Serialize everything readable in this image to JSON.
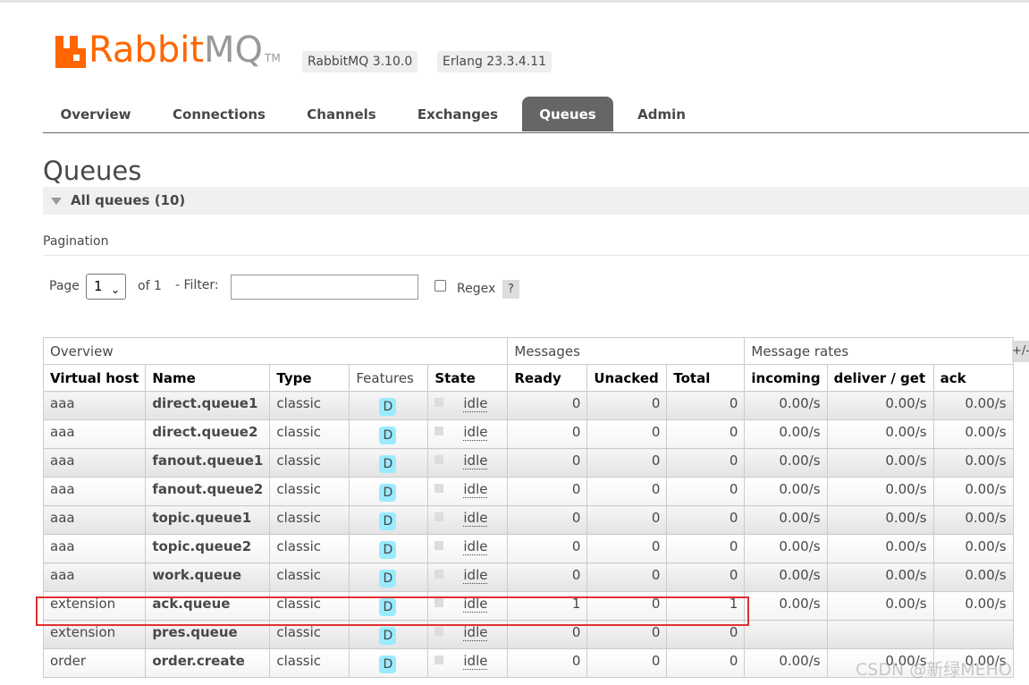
{
  "header": {
    "logo_rabbit": "Rabbit",
    "logo_mq": "MQ",
    "logo_tm": "TM",
    "rabbitmq_version": "RabbitMQ 3.10.0",
    "erlang_version": "Erlang 23.3.4.11"
  },
  "tabs": [
    {
      "label": "Overview",
      "active": false
    },
    {
      "label": "Connections",
      "active": false
    },
    {
      "label": "Channels",
      "active": false
    },
    {
      "label": "Exchanges",
      "active": false
    },
    {
      "label": "Queues",
      "active": true
    },
    {
      "label": "Admin",
      "active": false
    }
  ],
  "page": {
    "title": "Queues",
    "section_label": "All queues (10)",
    "pagination_heading": "Pagination"
  },
  "controls": {
    "page_label": "Page",
    "page_value": "1",
    "of_label": "of 1",
    "filter_label": "- Filter:",
    "filter_value": "",
    "regex_label": "Regex",
    "regex_checked": false,
    "help_label": "?",
    "plus_label": "+/-"
  },
  "table": {
    "groups": [
      "Overview",
      "Messages",
      "Message rates"
    ],
    "columns": [
      "Virtual host",
      "Name",
      "Type",
      "Features",
      "State",
      "Ready",
      "Unacked",
      "Total",
      "incoming",
      "deliver / get",
      "ack"
    ],
    "rows": [
      {
        "vhost": "aaa",
        "name": "direct.queue1",
        "type": "classic",
        "feature": "D",
        "state": "idle",
        "ready": "0",
        "unacked": "0",
        "total": "0",
        "incoming": "0.00/s",
        "deliver": "0.00/s",
        "ack": "0.00/s"
      },
      {
        "vhost": "aaa",
        "name": "direct.queue2",
        "type": "classic",
        "feature": "D",
        "state": "idle",
        "ready": "0",
        "unacked": "0",
        "total": "0",
        "incoming": "0.00/s",
        "deliver": "0.00/s",
        "ack": "0.00/s"
      },
      {
        "vhost": "aaa",
        "name": "fanout.queue1",
        "type": "classic",
        "feature": "D",
        "state": "idle",
        "ready": "0",
        "unacked": "0",
        "total": "0",
        "incoming": "0.00/s",
        "deliver": "0.00/s",
        "ack": "0.00/s"
      },
      {
        "vhost": "aaa",
        "name": "fanout.queue2",
        "type": "classic",
        "feature": "D",
        "state": "idle",
        "ready": "0",
        "unacked": "0",
        "total": "0",
        "incoming": "0.00/s",
        "deliver": "0.00/s",
        "ack": "0.00/s"
      },
      {
        "vhost": "aaa",
        "name": "topic.queue1",
        "type": "classic",
        "feature": "D",
        "state": "idle",
        "ready": "0",
        "unacked": "0",
        "total": "0",
        "incoming": "0.00/s",
        "deliver": "0.00/s",
        "ack": "0.00/s"
      },
      {
        "vhost": "aaa",
        "name": "topic.queue2",
        "type": "classic",
        "feature": "D",
        "state": "idle",
        "ready": "0",
        "unacked": "0",
        "total": "0",
        "incoming": "0.00/s",
        "deliver": "0.00/s",
        "ack": "0.00/s"
      },
      {
        "vhost": "aaa",
        "name": "work.queue",
        "type": "classic",
        "feature": "D",
        "state": "idle",
        "ready": "0",
        "unacked": "0",
        "total": "0",
        "incoming": "0.00/s",
        "deliver": "0.00/s",
        "ack": "0.00/s"
      },
      {
        "vhost": "extension",
        "name": "ack.queue",
        "type": "classic",
        "feature": "D",
        "state": "idle",
        "ready": "1",
        "unacked": "0",
        "total": "1",
        "incoming": "0.00/s",
        "deliver": "0.00/s",
        "ack": "0.00/s"
      },
      {
        "vhost": "extension",
        "name": "pres.queue",
        "type": "classic",
        "feature": "D",
        "state": "idle",
        "ready": "0",
        "unacked": "0",
        "total": "0",
        "incoming": "",
        "deliver": "",
        "ack": ""
      },
      {
        "vhost": "order",
        "name": "order.create",
        "type": "classic",
        "feature": "D",
        "state": "idle",
        "ready": "0",
        "unacked": "0",
        "total": "0",
        "incoming": "0.00/s",
        "deliver": "0.00/s",
        "ack": "0.00/s"
      }
    ]
  },
  "watermark": "CSDN @新绿MEHO",
  "colors": {
    "brand_orange": "#ff6600",
    "active_tab": "#666666",
    "feature_badge": "#99ebff",
    "highlight_red": "#e0302f"
  }
}
